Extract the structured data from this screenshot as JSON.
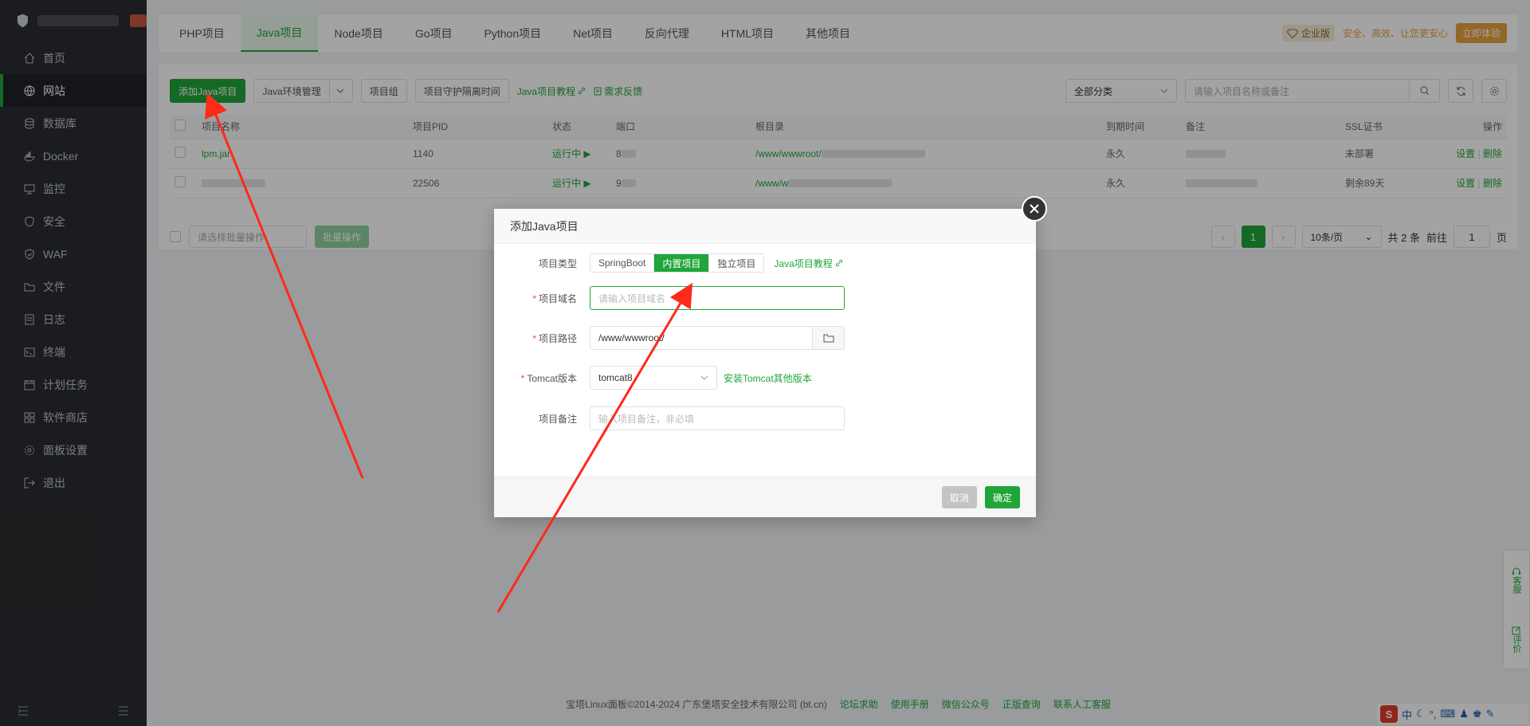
{
  "sidebar": {
    "items": [
      {
        "label": "首页",
        "icon": "home-icon"
      },
      {
        "label": "网站",
        "icon": "globe-icon"
      },
      {
        "label": "数据库",
        "icon": "database-icon"
      },
      {
        "label": "Docker",
        "icon": "docker-icon"
      },
      {
        "label": "监控",
        "icon": "monitor-icon"
      },
      {
        "label": "安全",
        "icon": "shield-icon"
      },
      {
        "label": "WAF",
        "icon": "waf-icon"
      },
      {
        "label": "文件",
        "icon": "folder-icon"
      },
      {
        "label": "日志",
        "icon": "log-icon"
      },
      {
        "label": "终端",
        "icon": "terminal-icon"
      },
      {
        "label": "计划任务",
        "icon": "clock-icon"
      },
      {
        "label": "软件商店",
        "icon": "grid-icon"
      },
      {
        "label": "面板设置",
        "icon": "gear-icon"
      },
      {
        "label": "退出",
        "icon": "logout-icon"
      }
    ]
  },
  "tabs": [
    "PHP项目",
    "Java项目",
    "Node项目",
    "Go项目",
    "Python项目",
    "Net项目",
    "反向代理",
    "HTML项目",
    "其他项目"
  ],
  "enterprise": {
    "tag": "企业版",
    "text": "安全、高效、让您更安心",
    "button": "立即体验"
  },
  "toolbar": {
    "add_button": "添加Java项目",
    "env_button": "Java环境管理",
    "group_button": "项目组",
    "guard_button": "项目守护隔离时间",
    "tutorial_link": "Java项目教程",
    "feedback_link": "需求反馈",
    "category_select": "全部分类",
    "search_placeholder": "请输入项目名称或备注"
  },
  "table": {
    "headers": {
      "name": "项目名称",
      "pid": "项目PID",
      "status": "状态",
      "port": "端口",
      "root": "根目录",
      "expire": "到期时间",
      "remark": "备注",
      "ssl": "SSL证书",
      "ops": "操作"
    },
    "rows": [
      {
        "name": "lpm.jar",
        "pid": "1140",
        "status": "运行中",
        "port": "8",
        "root": "/www/wwwroot/",
        "expire": "永久",
        "ssl": "未部署",
        "set": "设置",
        "del": "删除"
      },
      {
        "name": "",
        "pid": "22506",
        "status": "运行中",
        "port": "9",
        "root": "/www/w",
        "expire": "永久",
        "ssl": "剩余89天",
        "set": "设置",
        "del": "删除"
      }
    ]
  },
  "batch": {
    "select": "请选择批量操作",
    "button": "批量操作"
  },
  "pager": {
    "page": "1",
    "per_page": "10条/页",
    "total": "共 2 条",
    "goto": "前往",
    "goto_value": "1",
    "page_suffix": "页"
  },
  "footer": {
    "copyright": "宝塔Linux面板©2014-2024 广东堡塔安全技术有限公司 (bt.cn)",
    "links": [
      "论坛求助",
      "使用手册",
      "微信公众号",
      "正版查询",
      "联系人工客服"
    ]
  },
  "float": {
    "service": "客服",
    "review": "评价"
  },
  "ime": {
    "logo": "S",
    "lang": "中"
  },
  "modal": {
    "title": "添加Java项目",
    "type_label": "项目类型",
    "types": [
      "SpringBoot",
      "内置项目",
      "独立项目"
    ],
    "tutorial": "Java项目教程",
    "domain_label": "项目域名",
    "domain_placeholder": "请输入项目域名",
    "path_label": "项目路径",
    "path_value": "/www/wwwroot/",
    "tomcat_label": "Tomcat版本",
    "tomcat_value": "tomcat8",
    "tomcat_install": "安装Tomcat其他版本",
    "remark_label": "项目备注",
    "remark_placeholder": "输入项目备注，非必填",
    "cancel": "取消",
    "confirm": "确定"
  },
  "colors": {
    "accent": "#20a53a",
    "warning": "#e6a23c",
    "arrow": "#ff2a1a"
  }
}
